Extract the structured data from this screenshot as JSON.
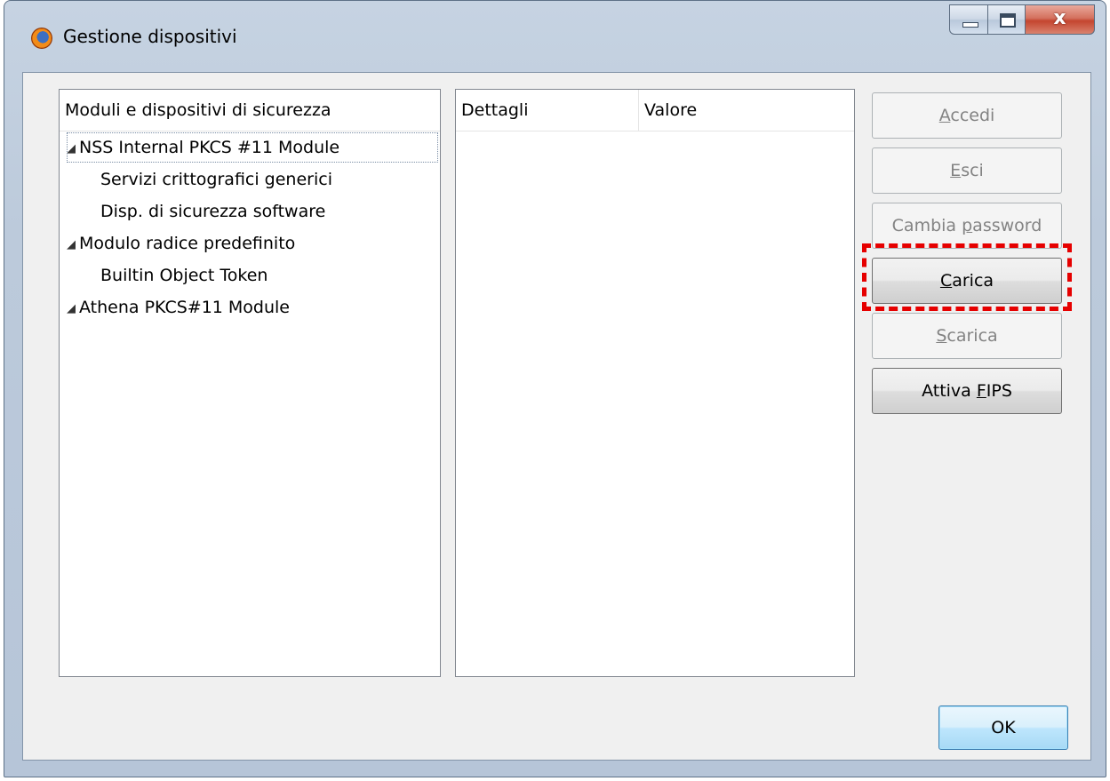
{
  "window": {
    "title": "Gestione dispositivi",
    "caption": {
      "minimize": "",
      "maximize": "",
      "close": "x"
    }
  },
  "tree": {
    "header": "Moduli e dispositivi di sicurezza",
    "items": [
      {
        "label": "NSS Internal PKCS #11 Module",
        "expanded": true,
        "selected": true
      },
      {
        "label": "Servizi crittografici generici"
      },
      {
        "label": "Disp. di sicurezza software"
      },
      {
        "label": "Modulo radice predefinito",
        "expanded": true
      },
      {
        "label": "Builtin Object Token"
      },
      {
        "label": "Athena PKCS#11 Module",
        "expanded": true
      }
    ],
    "expand_glyph": "◢"
  },
  "details": {
    "columns": [
      "Dettagli",
      "Valore"
    ]
  },
  "buttons": {
    "accedi": {
      "accel": "A",
      "rest": "ccedi",
      "enabled": false
    },
    "esci": {
      "accel": "E",
      "rest": "sci",
      "enabled": false
    },
    "cambia_password": {
      "before": "Cambia ",
      "accel": "p",
      "rest": "assword",
      "enabled": false
    },
    "carica": {
      "accel": "C",
      "rest": "arica",
      "enabled": true,
      "highlighted": true
    },
    "scarica": {
      "accel": "S",
      "rest": "carica",
      "enabled": false
    },
    "attiva_fips": {
      "before": "Attiva ",
      "accel": "F",
      "rest": "IPS",
      "enabled": true
    },
    "ok": "OK"
  },
  "colors": {
    "highlight": "#e60000",
    "disabled_text": "#838383"
  }
}
